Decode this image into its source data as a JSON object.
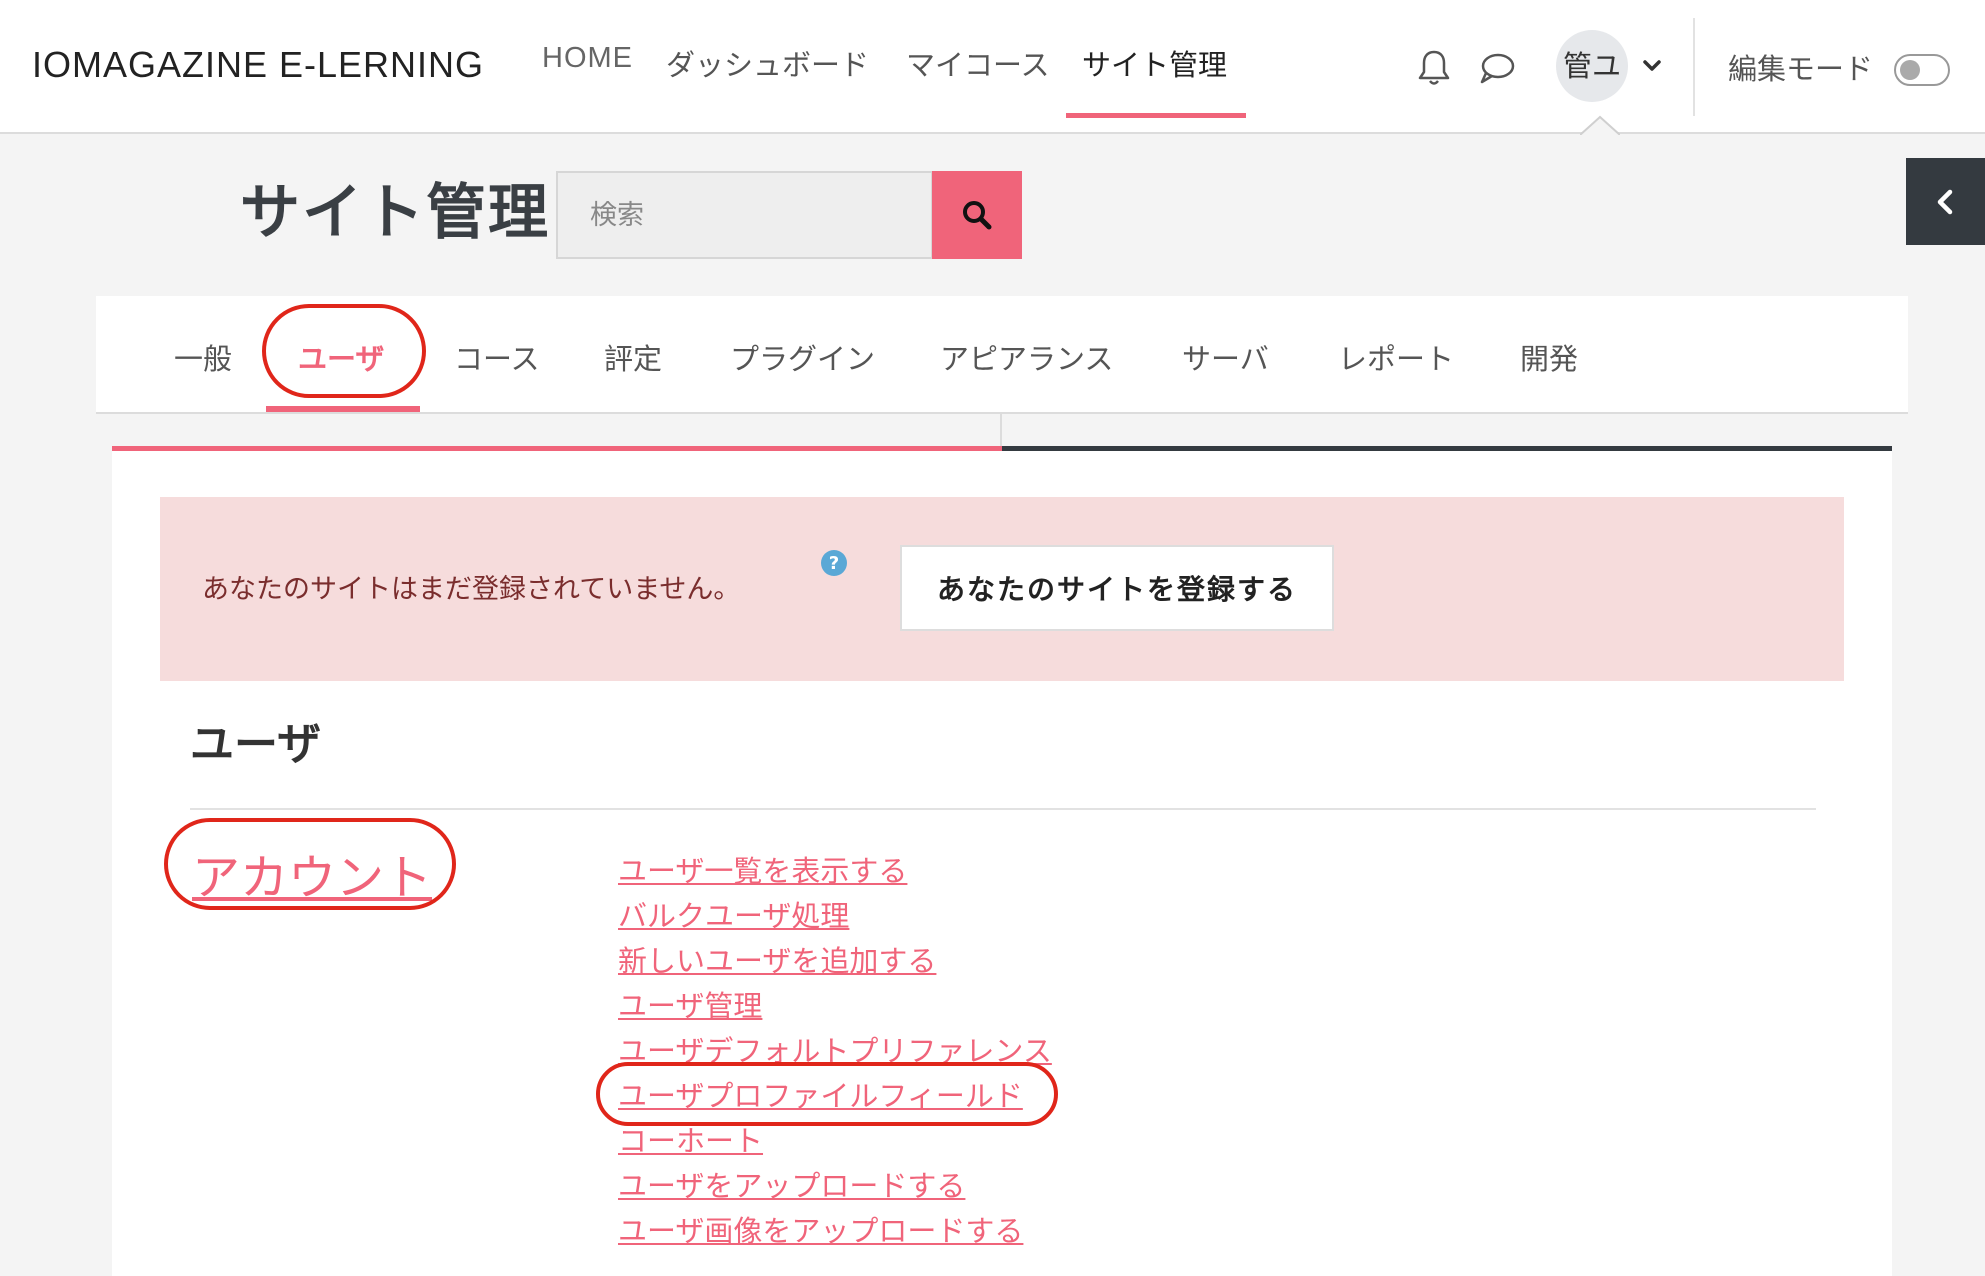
{
  "navbar": {
    "brand": "IOMAGAZINE E-LERNING",
    "links": [
      {
        "label": "HOME"
      },
      {
        "label": "ダッシュボード"
      },
      {
        "label": "マイコース"
      },
      {
        "label": "サイト管理",
        "active": true
      }
    ],
    "notifications_icon": "bell-icon",
    "messages_icon": "chat-bubble-icon",
    "user_initials": "管ユ",
    "edit_mode_label": "編集モード",
    "edit_mode_on": false
  },
  "page": {
    "title": "サイト管理",
    "search_placeholder": "検索"
  },
  "tabs": [
    {
      "label": "一般"
    },
    {
      "label": "ユーザ",
      "active": true
    },
    {
      "label": "コース"
    },
    {
      "label": "評定"
    },
    {
      "label": "プラグイン"
    },
    {
      "label": "アピアランス"
    },
    {
      "label": "サーバ"
    },
    {
      "label": "レポート"
    },
    {
      "label": "開発"
    }
  ],
  "alert": {
    "text": "あなたのサイトはまだ登録されていません。",
    "button": "あなたのサイトを登録する"
  },
  "section": {
    "title": "ユーザ",
    "category": "アカウント",
    "links": [
      "ユーザ一覧を表示する",
      "バルクユーザ処理",
      "新しいユーザを追加する",
      "ユーザ管理",
      "ユーザデフォルトプリファレンス",
      "ユーザプロファイルフィールド",
      "コーホート",
      "ユーザをアップロードする",
      "ユーザ画像をアップロードする"
    ]
  },
  "colors": {
    "accent": "#f0647a",
    "annotation": "#e0261a",
    "dark": "#343a40"
  }
}
